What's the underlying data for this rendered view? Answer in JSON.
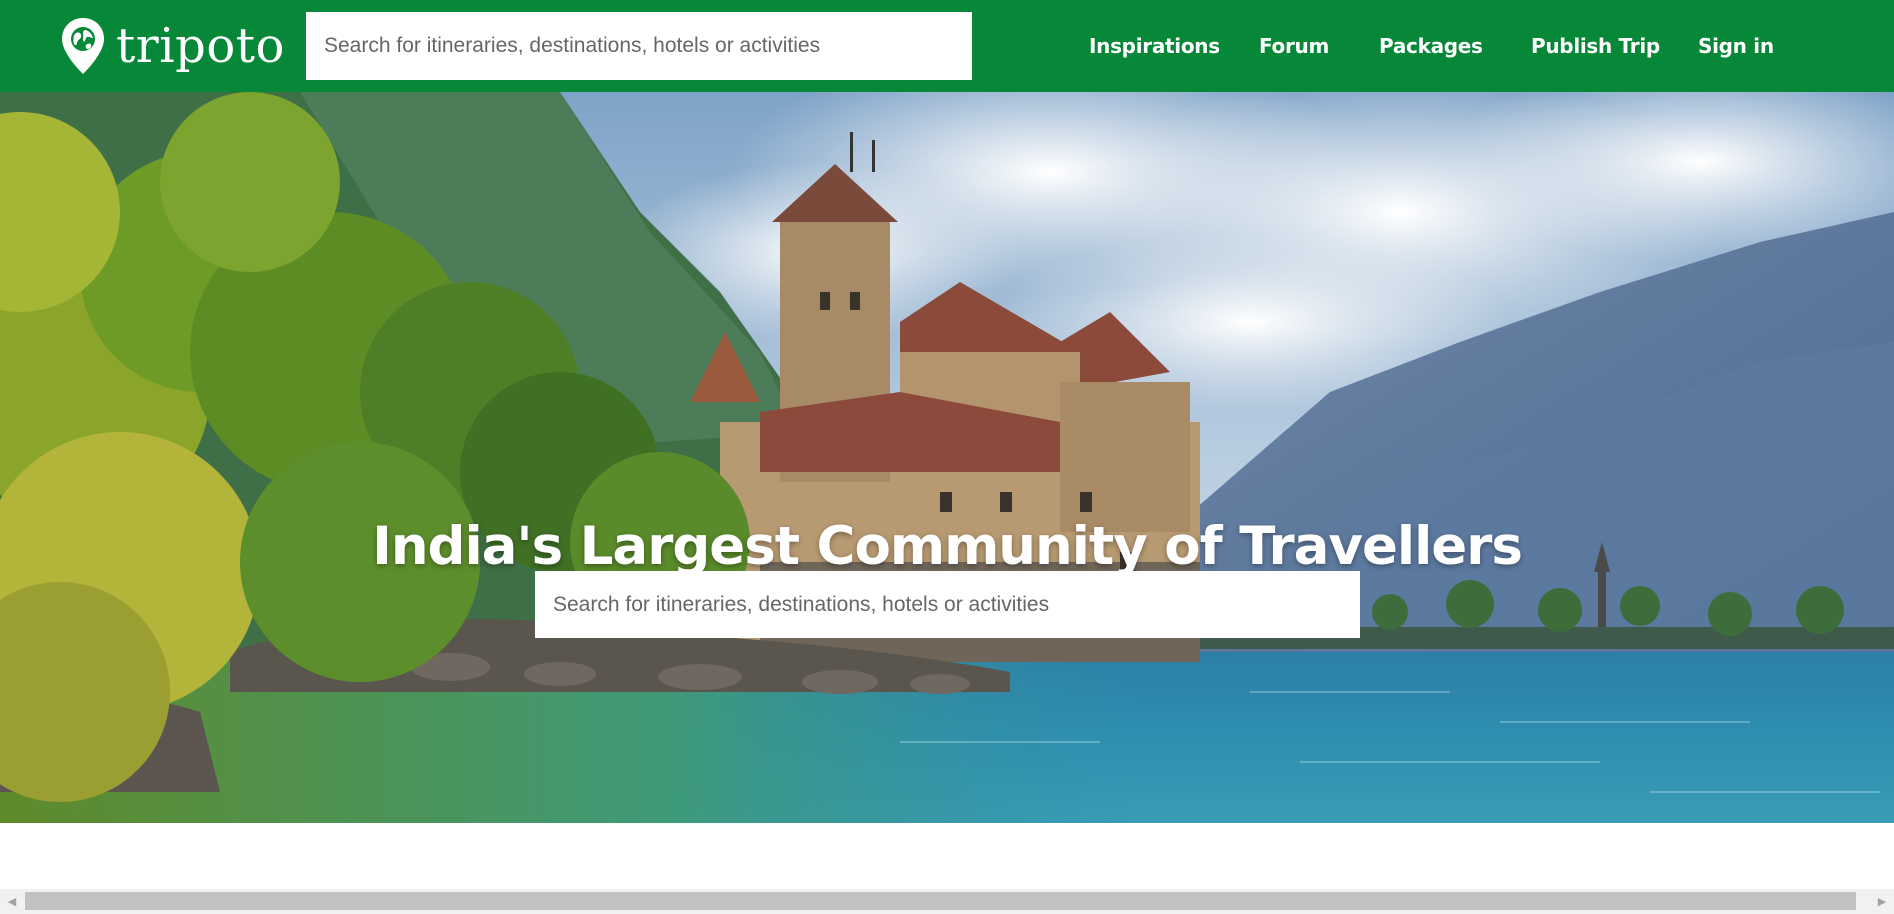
{
  "brand": {
    "name": "tripoto",
    "primary_color": "#078838",
    "logo_icon": "map-pin-globe-icon"
  },
  "header": {
    "search_placeholder": "Search for itineraries, destinations, hotels or activities",
    "nav": [
      {
        "label": "Inspirations"
      },
      {
        "label": "Forum"
      },
      {
        "label": "Packages"
      },
      {
        "label": "Publish Trip"
      },
      {
        "label": "Sign in"
      }
    ]
  },
  "hero": {
    "title": "India's Largest Community of Travellers",
    "search_placeholder": "Search for itineraries, destinations, hotels or activities"
  },
  "scrollbar": {
    "left_arrow_icon": "arrow-left-icon",
    "right_arrow_icon": "arrow-right-icon"
  }
}
